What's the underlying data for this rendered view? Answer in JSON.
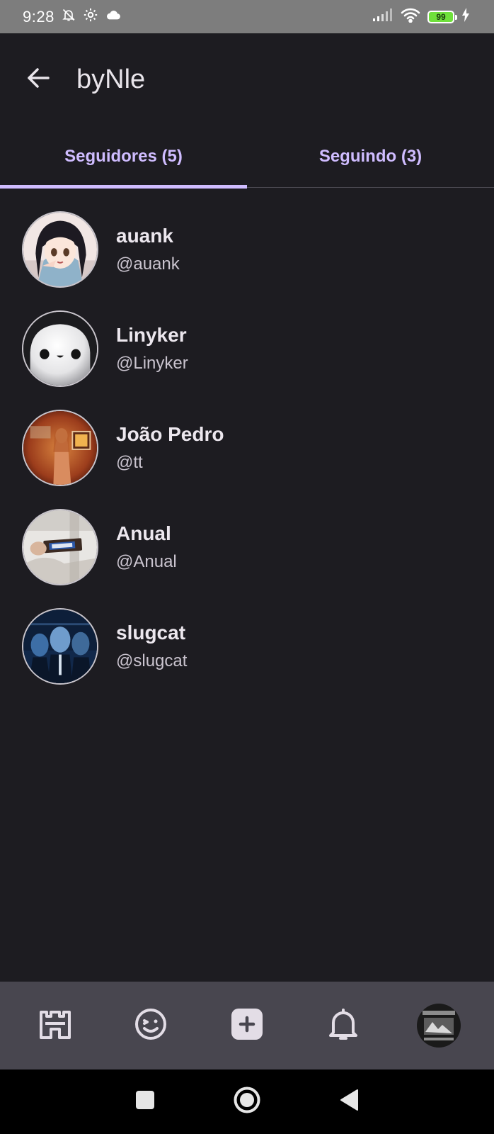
{
  "status_bar": {
    "time": "9:28",
    "battery": "99",
    "icons": [
      "bell-off-icon",
      "settings-icon",
      "cloud-icon",
      "signal-icon",
      "wifi-icon",
      "battery-icon",
      "charging-icon"
    ]
  },
  "header": {
    "title": "byNle",
    "back_icon": "arrow-left-icon"
  },
  "tabs": [
    {
      "label": "Seguidores (5)",
      "active": true
    },
    {
      "label": "Seguindo (3)",
      "active": false
    }
  ],
  "users": [
    {
      "name": "auank",
      "handle": "@auank"
    },
    {
      "name": "Linyker",
      "handle": "@Linyker"
    },
    {
      "name": "João Pedro",
      "handle": "@tt"
    },
    {
      "name": "Anual",
      "handle": "@Anual"
    },
    {
      "name": "slugcat",
      "handle": "@slugcat"
    }
  ],
  "bottom_nav": {
    "items": [
      "castle-icon",
      "smiley-icon",
      "add-post-icon",
      "bell-icon",
      "profile-avatar"
    ]
  },
  "system_nav": {
    "items": [
      "recents-icon",
      "home-icon",
      "back-icon"
    ]
  },
  "colors": {
    "background": "#1d1c21",
    "accent": "#cfbcff",
    "nav_bar": "#48464f",
    "status_bar": "#7d7d7d"
  }
}
